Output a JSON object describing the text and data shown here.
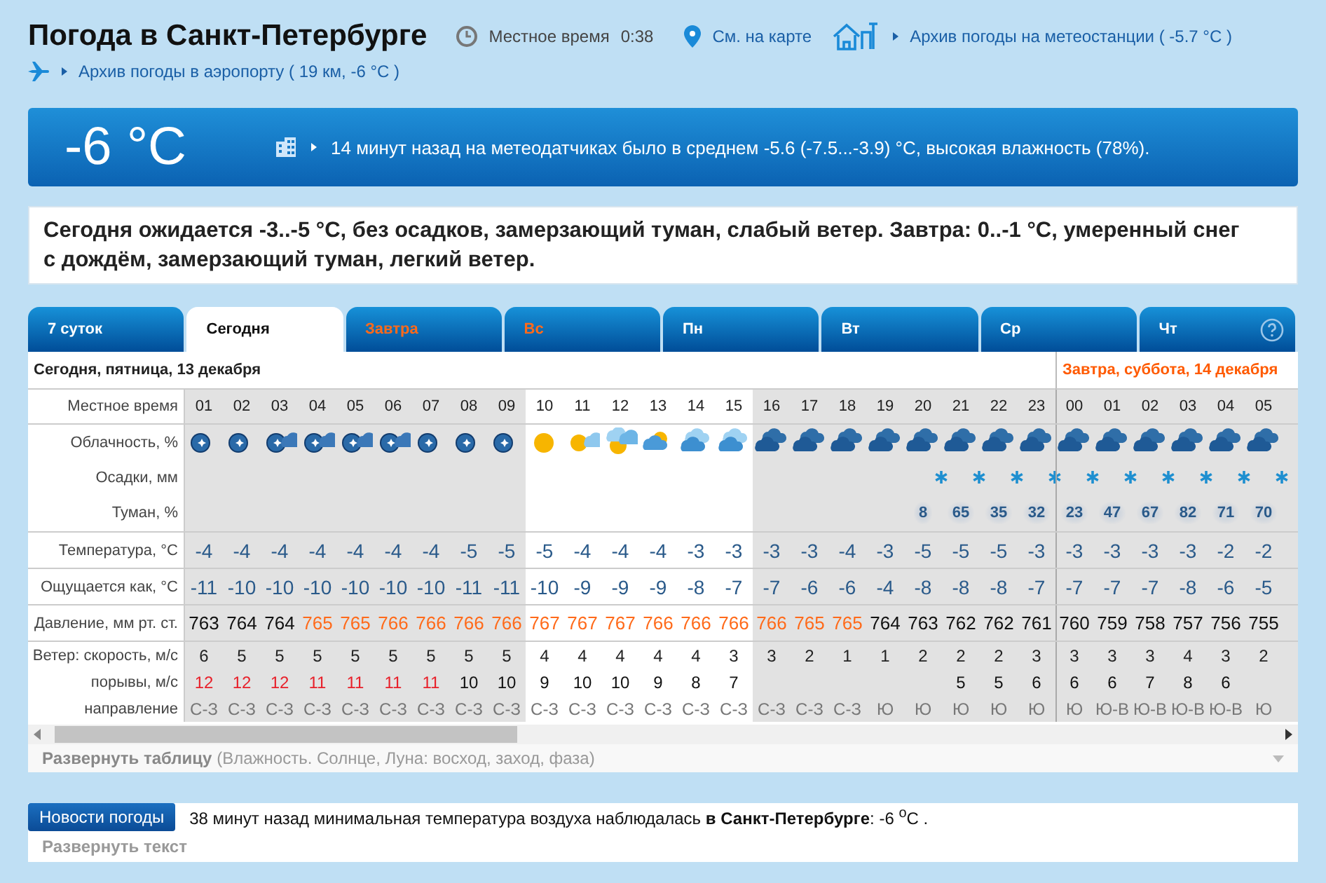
{
  "header": {
    "title": "Погода в Санкт-Петербурге",
    "local_time_label": "Местное время",
    "local_time": "0:38",
    "map_link": "См. на карте",
    "station_archive": "Архив погоды на метеостанции ( -5.7 °C )",
    "airport_archive": "Архив погоды в аэропорту ( 19 км, -6 °C )"
  },
  "current": {
    "temperature": "-6 °C",
    "note": "14 минут назад на метеодатчиках было в среднем -5.6 (-7.5...-3.9) °C, высокая влажность (78%)."
  },
  "summary": "Сегодня ожидается -3..-5 °C, без осадков, замерзающий туман, слабый ветер. Завтра: 0..-1 °C, умеренный снег с дождём, замерзающий туман, легкий ветер.",
  "tabs": [
    {
      "label": "7 суток",
      "selected": false,
      "weekend": false
    },
    {
      "label": "Сегодня",
      "selected": true,
      "weekend": false
    },
    {
      "label": "Завтра",
      "selected": false,
      "weekend": true
    },
    {
      "label": "Вс",
      "selected": false,
      "weekend": true
    },
    {
      "label": "Пн",
      "selected": false,
      "weekend": false
    },
    {
      "label": "Вт",
      "selected": false,
      "weekend": false
    },
    {
      "label": "Ср",
      "selected": false,
      "weekend": false
    },
    {
      "label": "Чт",
      "selected": false,
      "weekend": false
    }
  ],
  "dates": {
    "today": "Сегодня, пятница, 13 декабря",
    "tomorrow": "Завтра, суббота, 14 декабря"
  },
  "row_labels": {
    "time": "Местное время",
    "clouds": "Облачность, %",
    "precipitation": "Осадки, мм",
    "fog": "Туман, %",
    "temperature": "Температура, °C",
    "feels_like": "Ощущается как, °C",
    "pressure": "Давление, мм рт. ст.",
    "wind_speed": "Ветер: скорость, м/с",
    "gusts": "порывы, м/с",
    "direction": "направление"
  },
  "columns": [
    {
      "hour": "01",
      "night": true,
      "kind": "clear-night",
      "snow": false,
      "temp": "-4",
      "feels": "-11",
      "pressure": "763",
      "high_pressure": false,
      "wind": "6",
      "gust": "12",
      "strong_gust": true,
      "dir": "С-З"
    },
    {
      "hour": "02",
      "night": true,
      "kind": "clear-night",
      "snow": false,
      "temp": "-4",
      "feels": "-10",
      "pressure": "764",
      "high_pressure": false,
      "wind": "5",
      "gust": "12",
      "strong_gust": true,
      "dir": "С-З"
    },
    {
      "hour": "03",
      "night": true,
      "kind": "cloud-night",
      "snow": false,
      "temp": "-4",
      "feels": "-10",
      "pressure": "764",
      "high_pressure": false,
      "wind": "5",
      "gust": "12",
      "strong_gust": true,
      "dir": "С-З"
    },
    {
      "hour": "04",
      "night": true,
      "kind": "cloud-night",
      "snow": false,
      "temp": "-4",
      "feels": "-10",
      "pressure": "765",
      "high_pressure": true,
      "wind": "5",
      "gust": "11",
      "strong_gust": true,
      "dir": "С-З"
    },
    {
      "hour": "05",
      "night": true,
      "kind": "cloud-night",
      "snow": false,
      "temp": "-4",
      "feels": "-10",
      "pressure": "765",
      "high_pressure": true,
      "wind": "5",
      "gust": "11",
      "strong_gust": true,
      "dir": "С-З"
    },
    {
      "hour": "06",
      "night": true,
      "kind": "cloud-night",
      "snow": false,
      "temp": "-4",
      "feels": "-10",
      "pressure": "766",
      "high_pressure": true,
      "wind": "5",
      "gust": "11",
      "strong_gust": true,
      "dir": "С-З"
    },
    {
      "hour": "07",
      "night": true,
      "kind": "clear-night",
      "snow": false,
      "temp": "-4",
      "feels": "-10",
      "pressure": "766",
      "high_pressure": true,
      "wind": "5",
      "gust": "11",
      "strong_gust": true,
      "dir": "С-З"
    },
    {
      "hour": "08",
      "night": true,
      "kind": "clear-night",
      "snow": false,
      "temp": "-5",
      "feels": "-11",
      "pressure": "766",
      "high_pressure": true,
      "wind": "5",
      "gust": "10",
      "strong_gust": false,
      "dir": "С-З"
    },
    {
      "hour": "09",
      "night": true,
      "kind": "clear-night",
      "snow": false,
      "temp": "-5",
      "feels": "-11",
      "pressure": "766",
      "high_pressure": true,
      "wind": "5",
      "gust": "10",
      "strong_gust": false,
      "dir": "С-З"
    },
    {
      "hour": "10",
      "night": false,
      "kind": "sun",
      "snow": false,
      "temp": "-5",
      "feels": "-10",
      "pressure": "767",
      "high_pressure": true,
      "wind": "4",
      "gust": "9",
      "strong_gust": false,
      "dir": "С-З"
    },
    {
      "hour": "11",
      "night": false,
      "kind": "sun-cloud",
      "snow": false,
      "temp": "-4",
      "feels": "-9",
      "pressure": "767",
      "high_pressure": true,
      "wind": "4",
      "gust": "10",
      "strong_gust": false,
      "dir": "С-З"
    },
    {
      "hour": "12",
      "night": false,
      "kind": "sun-clouds",
      "snow": false,
      "temp": "-4",
      "feels": "-9",
      "pressure": "767",
      "high_pressure": true,
      "wind": "4",
      "gust": "10",
      "strong_gust": false,
      "dir": "С-З"
    },
    {
      "hour": "13",
      "night": false,
      "kind": "clouds-sun",
      "snow": false,
      "temp": "-4",
      "feels": "-9",
      "pressure": "766",
      "high_pressure": true,
      "wind": "4",
      "gust": "9",
      "strong_gust": false,
      "dir": "С-З"
    },
    {
      "hour": "14",
      "night": false,
      "kind": "cloudy",
      "snow": false,
      "temp": "-3",
      "feels": "-8",
      "pressure": "766",
      "high_pressure": true,
      "wind": "4",
      "gust": "8",
      "strong_gust": false,
      "dir": "С-З"
    },
    {
      "hour": "15",
      "night": false,
      "kind": "cloudy",
      "snow": false,
      "temp": "-3",
      "feels": "-7",
      "pressure": "766",
      "high_pressure": true,
      "wind": "3",
      "gust": "7",
      "strong_gust": false,
      "dir": "С-З"
    },
    {
      "hour": "16",
      "night": true,
      "kind": "overcast",
      "snow": false,
      "temp": "-3",
      "feels": "-7",
      "pressure": "766",
      "high_pressure": true,
      "wind": "3",
      "strong_gust": false,
      "dir": "С-З"
    },
    {
      "hour": "17",
      "night": true,
      "kind": "overcast",
      "snow": false,
      "temp": "-3",
      "feels": "-6",
      "pressure": "765",
      "high_pressure": true,
      "wind": "2",
      "strong_gust": false,
      "dir": "С-З"
    },
    {
      "hour": "18",
      "night": true,
      "kind": "overcast",
      "snow": false,
      "temp": "-4",
      "feels": "-6",
      "pressure": "765",
      "high_pressure": true,
      "wind": "1",
      "strong_gust": false,
      "dir": "С-З"
    },
    {
      "hour": "19",
      "night": true,
      "kind": "overcast",
      "snow": false,
      "temp": "-3",
      "feels": "-4",
      "pressure": "764",
      "high_pressure": false,
      "wind": "1",
      "strong_gust": false,
      "dir": "Ю"
    },
    {
      "hour": "20",
      "night": true,
      "kind": "overcast",
      "snow": true,
      "fog": "8",
      "temp": "-5",
      "feels": "-8",
      "pressure": "763",
      "high_pressure": false,
      "wind": "2",
      "strong_gust": false,
      "dir": "Ю"
    },
    {
      "hour": "21",
      "night": true,
      "kind": "overcast",
      "snow": true,
      "fog": "65",
      "temp": "-5",
      "feels": "-8",
      "pressure": "762",
      "high_pressure": false,
      "wind": "2",
      "gust": "5",
      "strong_gust": false,
      "dir": "Ю"
    },
    {
      "hour": "22",
      "night": true,
      "kind": "overcast",
      "snow": true,
      "fog": "35",
      "temp": "-5",
      "feels": "-8",
      "pressure": "762",
      "high_pressure": false,
      "wind": "2",
      "gust": "5",
      "strong_gust": false,
      "dir": "Ю"
    },
    {
      "hour": "23",
      "night": true,
      "kind": "overcast",
      "snow": true,
      "fog": "32",
      "temp": "-3",
      "feels": "-7",
      "pressure": "761",
      "high_pressure": false,
      "wind": "3",
      "gust": "6",
      "strong_gust": false,
      "dir": "Ю"
    },
    {
      "hour": "00",
      "night": true,
      "new_day": true,
      "kind": "overcast",
      "snow": true,
      "fog": "23",
      "temp": "-3",
      "feels": "-7",
      "pressure": "760",
      "high_pressure": false,
      "wind": "3",
      "gust": "6",
      "strong_gust": false,
      "dir": "Ю"
    },
    {
      "hour": "01",
      "night": true,
      "kind": "overcast",
      "snow": true,
      "fog": "47",
      "temp": "-3",
      "feels": "-7",
      "pressure": "759",
      "high_pressure": false,
      "wind": "3",
      "gust": "6",
      "strong_gust": false,
      "dir": "Ю-В"
    },
    {
      "hour": "02",
      "night": true,
      "kind": "overcast",
      "snow": true,
      "fog": "67",
      "temp": "-3",
      "feels": "-7",
      "pressure": "758",
      "high_pressure": false,
      "wind": "3",
      "gust": "7",
      "strong_gust": false,
      "dir": "Ю-В"
    },
    {
      "hour": "03",
      "night": true,
      "kind": "overcast",
      "snow": true,
      "fog": "82",
      "temp": "-3",
      "feels": "-8",
      "pressure": "757",
      "high_pressure": false,
      "wind": "4",
      "gust": "8",
      "strong_gust": false,
      "dir": "Ю-В"
    },
    {
      "hour": "04",
      "night": true,
      "kind": "overcast",
      "snow": true,
      "fog": "71",
      "temp": "-2",
      "feels": "-6",
      "pressure": "756",
      "high_pressure": false,
      "wind": "3",
      "gust": "6",
      "strong_gust": false,
      "dir": "Ю-В"
    },
    {
      "hour": "05",
      "night": true,
      "kind": "overcast",
      "snow": true,
      "fog": "70",
      "temp": "-2",
      "feels": "-5",
      "pressure": "755",
      "high_pressure": false,
      "wind": "2",
      "strong_gust": false,
      "dir": "Ю"
    }
  ],
  "expand_table": "**Развернуть таблицу** (Влажность. Солнце, Луна: восход, заход, фаза)",
  "news": {
    "tag": "Новости погоды",
    "text": "38 минут назад минимальная температура воздуха наблюдалась **в Санкт-Петербурге**: -6 $^{o}$C .",
    "expand": "Развернуть текст"
  }
}
